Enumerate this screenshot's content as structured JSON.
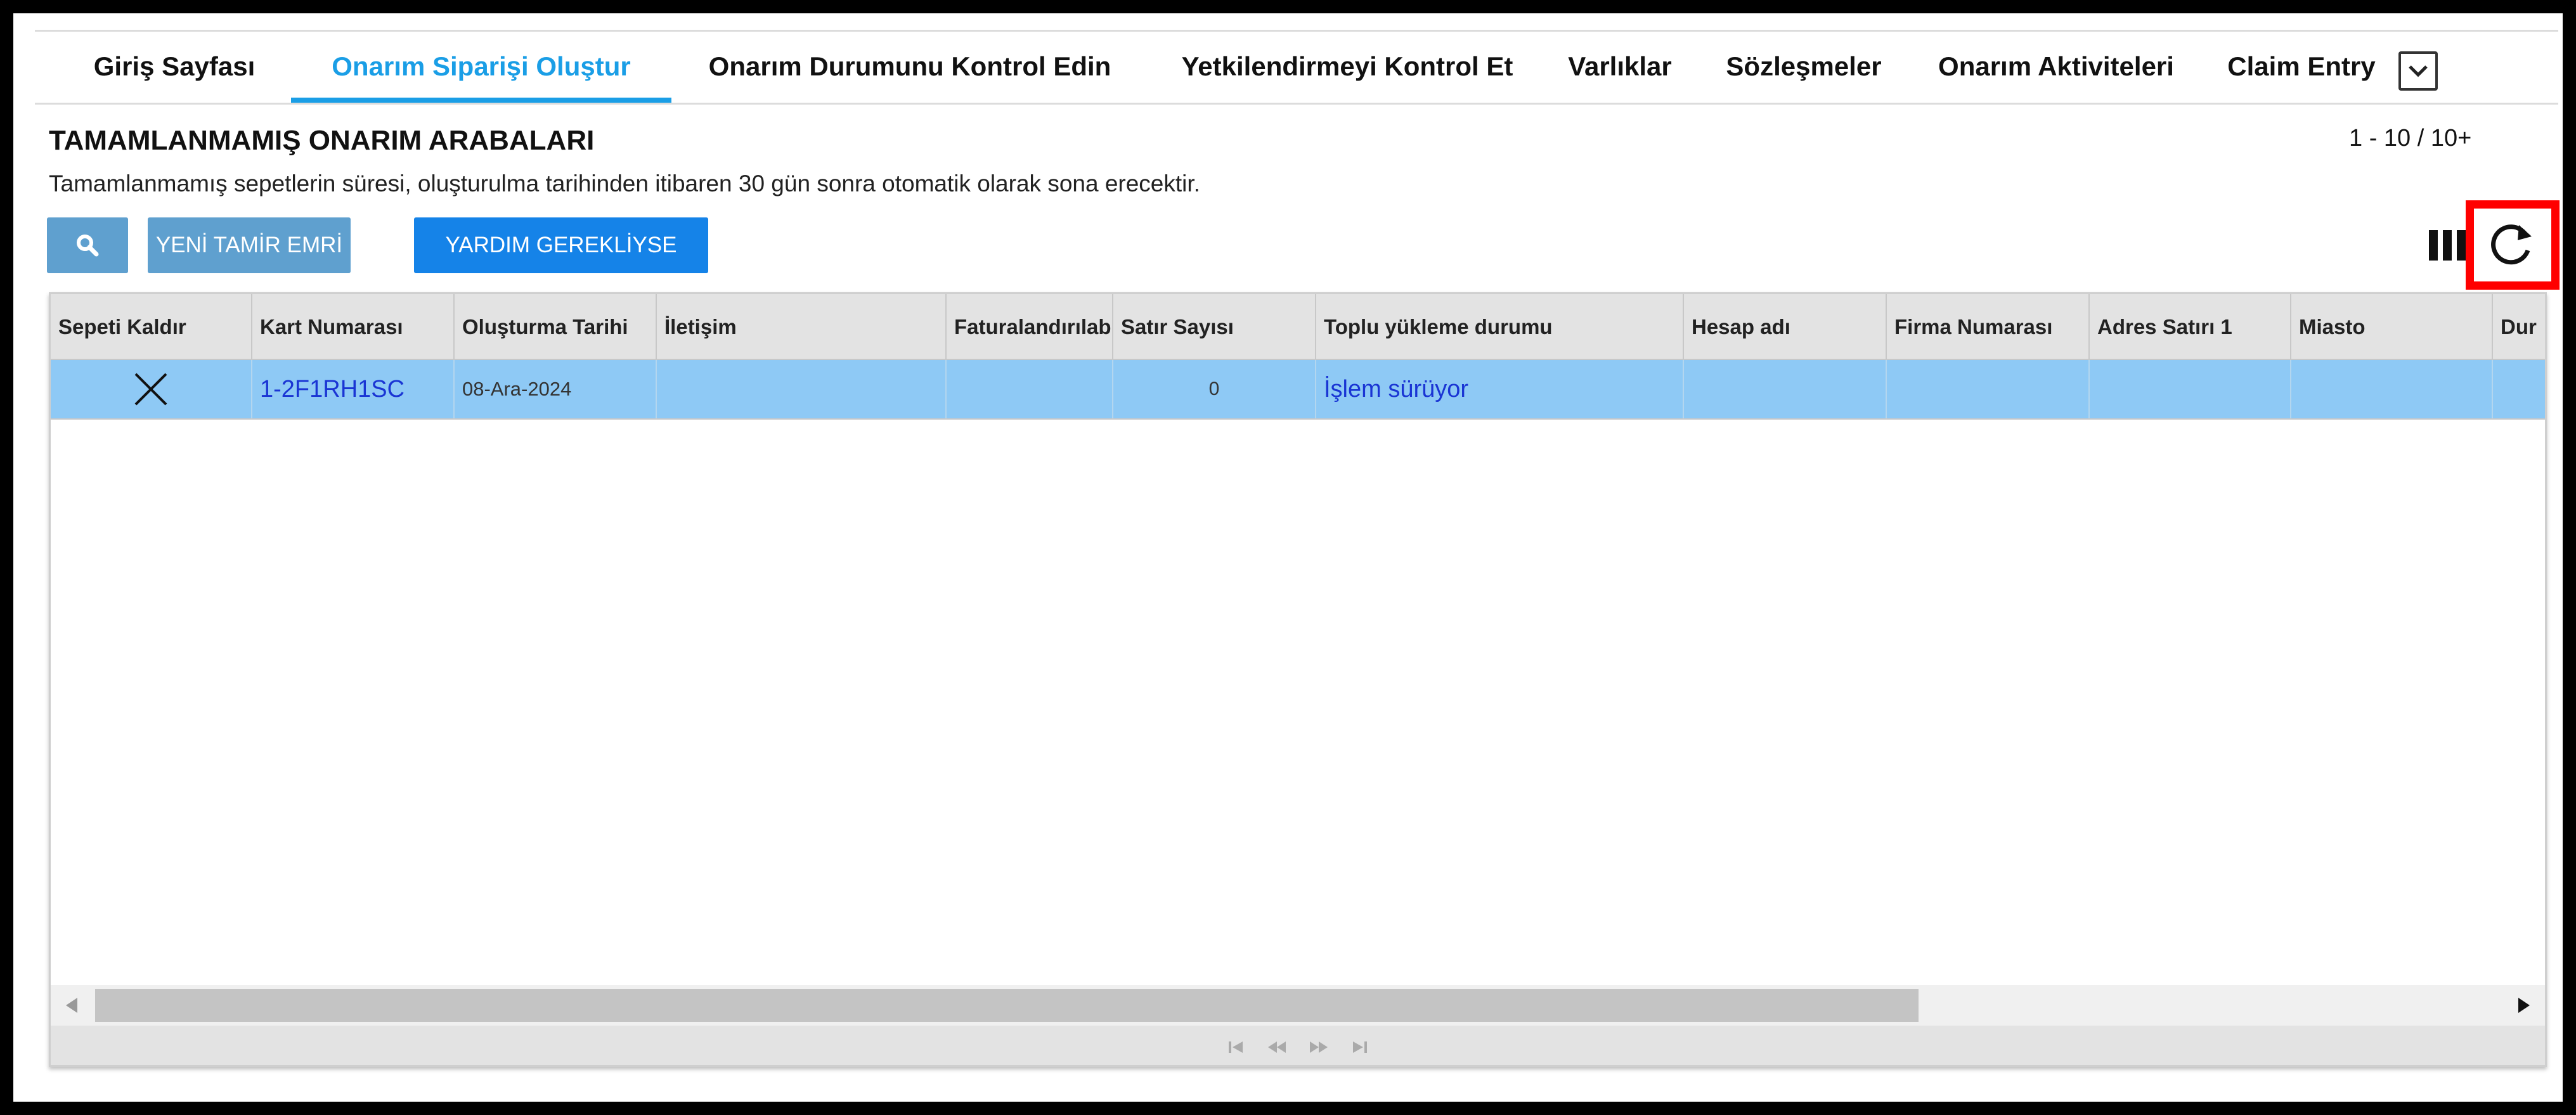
{
  "tabs": [
    {
      "label": "Giriş Sayfası"
    },
    {
      "label": "Onarım Siparişi Oluştur"
    },
    {
      "label": "Onarım Durumunu Kontrol Edin"
    },
    {
      "label": "Yetkilendirmeyi Kontrol Et"
    },
    {
      "label": "Varlıklar"
    },
    {
      "label": "Sözleşmeler"
    },
    {
      "label": "Onarım Aktiviteleri"
    },
    {
      "label": "Claim Entry"
    }
  ],
  "active_tab": "Onarım Siparişi Oluştur",
  "header": {
    "title": "TAMAMLANMAMIŞ ONARIM ARABALARI",
    "record_count": "1 - 10 / 10+",
    "description": "Tamamlanmamış sepetlerin süresi, oluşturulma tarihinden itibaren 30 gün sonra otomatik olarak sona erecektir."
  },
  "toolbar": {
    "search_icon": "search-icon",
    "new_order_label": "YENİ TAMİR EMRİ",
    "help_label": "YARDIM GEREKLİYSE",
    "columns_icon": "columns-icon",
    "refresh_icon": "refresh-icon"
  },
  "grid": {
    "columns": [
      "Sepeti Kaldır",
      "Kart Numarası",
      "Oluşturma Tarihi",
      "İletişim",
      "Faturalandırılab",
      "Satır Sayısı",
      "Toplu yükleme durumu",
      "Hesap adı",
      "Firma Numarası",
      "Adres Satırı 1",
      "Miasto",
      "Dur"
    ],
    "rows": [
      {
        "remove_icon": "close-icon",
        "card_number": "1-2F1RH1SC",
        "created": "08-Ara-2024",
        "contact": "",
        "billable": "",
        "line_count": "0",
        "bulk_status": "İşlem sürüyor",
        "account_name": "",
        "company_number": "",
        "address_line_1": "",
        "city": ""
      }
    ],
    "selected_row_color": "#8ec9f5"
  },
  "colors": {
    "accent": "#1a9ee6",
    "button_light": "#5fa0cf",
    "button_primary": "#1583e8",
    "highlight_box": "#ff0000"
  }
}
